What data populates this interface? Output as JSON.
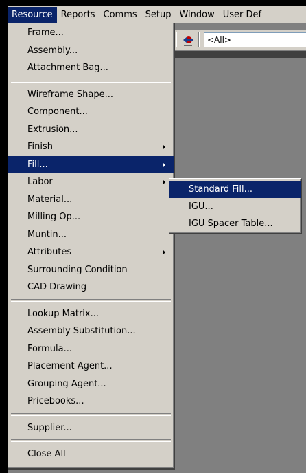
{
  "menubar": {
    "items": [
      "Resource",
      "Reports",
      "Comms",
      "Setup",
      "Window",
      "User Def"
    ]
  },
  "toolbar": {
    "filter_value": "<All>",
    "icon": "left-arrow-icon"
  },
  "resource_menu": {
    "frame": "Frame...",
    "assembly": "Assembly...",
    "attachment_bag": "Attachment Bag...",
    "wireframe_shape": "Wireframe Shape...",
    "component": "Component...",
    "extrusion": "Extrusion...",
    "finish": "Finish",
    "fill": "Fill...",
    "labor": "Labor",
    "material": "Material...",
    "milling_op": "Milling Op...",
    "muntin": "Muntin...",
    "attributes": "Attributes",
    "surrounding_condition": "Surrounding Condition",
    "cad_drawing": "CAD Drawing",
    "lookup_matrix": "Lookup Matrix...",
    "assembly_substitution": "Assembly Substitution...",
    "formula": "Formula...",
    "placement_agent": "Placement Agent...",
    "grouping_agent": "Grouping Agent...",
    "pricebooks": "Pricebooks...",
    "supplier": "Supplier...",
    "close_all": "Close All"
  },
  "fill_submenu": {
    "standard_fill": "Standard Fill...",
    "igu": "IGU...",
    "igu_spacer_table": "IGU Spacer Table..."
  },
  "colors": {
    "highlight": "#0a246a",
    "menu_bg": "#d4d0c8",
    "workspace": "#808080"
  }
}
